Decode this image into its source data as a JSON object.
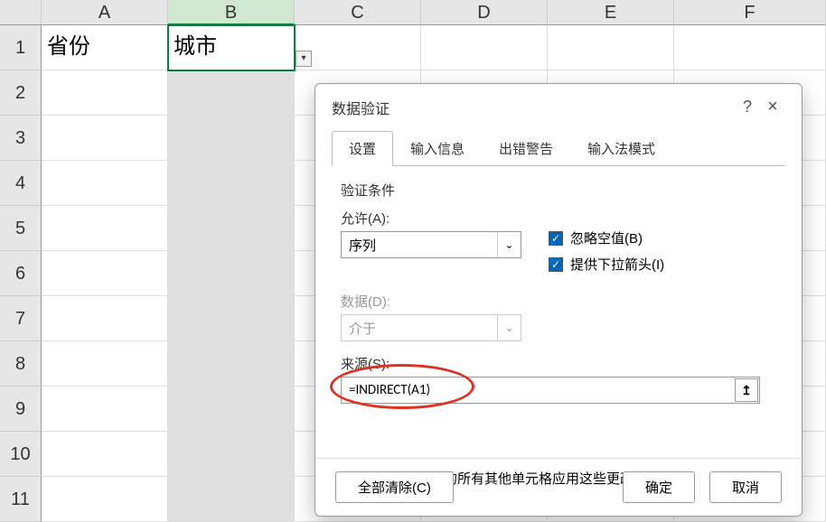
{
  "columns": [
    "A",
    "B",
    "C",
    "D",
    "E",
    "F"
  ],
  "rows": [
    "1",
    "2",
    "3",
    "4",
    "5",
    "6",
    "7",
    "8",
    "9",
    "10",
    "11"
  ],
  "cells": {
    "A1": "省份",
    "B1": "城市"
  },
  "selected_column": "B",
  "dropdown_indicator": "▾",
  "dialog": {
    "title": "数据验证",
    "help": "?",
    "close": "×",
    "tabs": [
      "设置",
      "输入信息",
      "出错警告",
      "输入法模式"
    ],
    "active_tab": 0,
    "section": "验证条件",
    "allow_label": "允许(A):",
    "allow_value": "序列",
    "data_label": "数据(D):",
    "data_value": "介于",
    "ignore_blank": "忽略空值(B)",
    "in_cell_dropdown": "提供下拉箭头(I)",
    "source_label": "来源(S):",
    "source_value": "=INDIRECT(A1)",
    "range_icon": "↥",
    "apply_all": "对有同样设置的所有其他单元格应用这些更改(P)",
    "clear_all": "全部清除(C)",
    "ok": "确定",
    "cancel": "取消",
    "select_arrow": "⌄",
    "check": "✓"
  }
}
